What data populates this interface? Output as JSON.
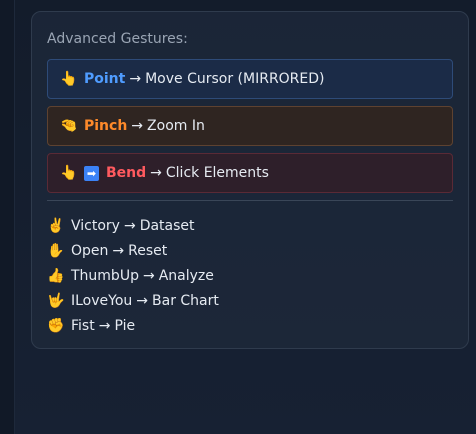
{
  "panel": {
    "title": "Advanced Gestures:"
  },
  "cards": [
    {
      "emoji": "👆",
      "keyword": "Point",
      "arrow": "→",
      "action": "Move Cursor (MIRRORED)",
      "color": "#4f9cff"
    },
    {
      "emoji": "🤏",
      "keyword": "Pinch",
      "arrow": "→",
      "action": "Zoom In",
      "color": "#ff8a2a"
    },
    {
      "emoji": "👆",
      "emoji2": "➡",
      "keyword": "Bend",
      "arrow": "→",
      "action": "Click Elements",
      "color": "#ff5a5f"
    }
  ],
  "list": [
    {
      "emoji": "✌️",
      "name": "Victory",
      "arrow": "→",
      "action": "Dataset"
    },
    {
      "emoji": "✋",
      "name": "Open",
      "arrow": "→",
      "action": "Reset"
    },
    {
      "emoji": "👍",
      "name": "ThumbUp",
      "arrow": "→",
      "action": "Analyze"
    },
    {
      "emoji": "🤟",
      "name": "ILoveYou",
      "arrow": "→",
      "action": "Bar Chart"
    },
    {
      "emoji": "✊",
      "name": "Fist",
      "arrow": "→",
      "action": "Pie"
    }
  ]
}
